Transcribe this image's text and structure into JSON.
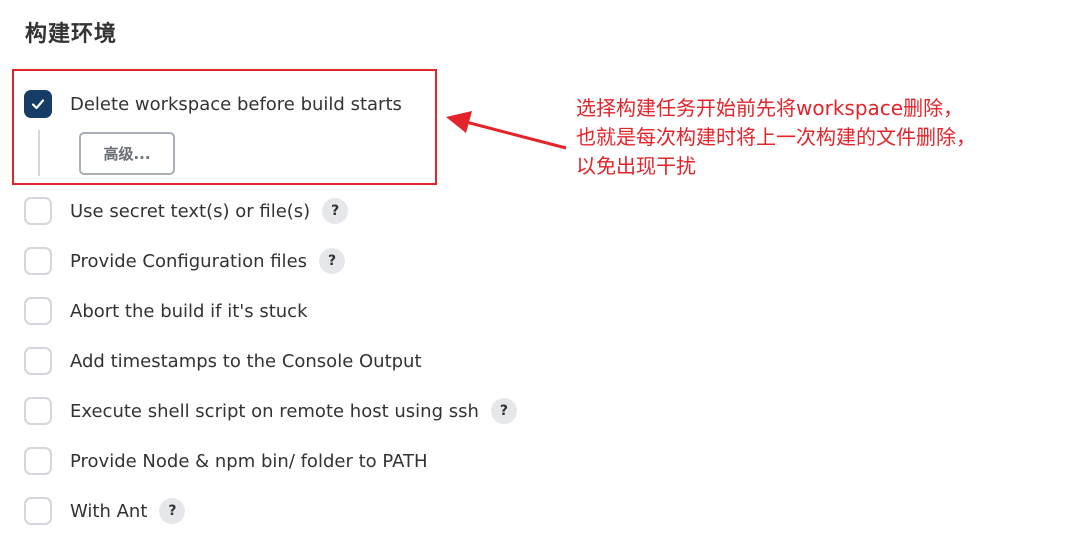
{
  "section": {
    "title": "构建环境"
  },
  "options": [
    {
      "label": "Delete workspace before build starts",
      "checked": true,
      "help": false
    },
    {
      "label": "Use secret text(s) or file(s)",
      "checked": false,
      "help": true
    },
    {
      "label": "Provide Configuration files",
      "checked": false,
      "help": true
    },
    {
      "label": "Abort the build if it's stuck",
      "checked": false,
      "help": false
    },
    {
      "label": "Add timestamps to the Console Output",
      "checked": false,
      "help": false
    },
    {
      "label": "Execute shell script on remote host using ssh",
      "checked": false,
      "help": true
    },
    {
      "label": "Provide Node & npm bin/ folder to PATH",
      "checked": false,
      "help": false
    },
    {
      "label": "With Ant",
      "checked": false,
      "help": true
    }
  ],
  "advanced_button": {
    "label": "高级..."
  },
  "help_icon": {
    "glyph": "?"
  },
  "annotation": {
    "lines": [
      "选择构建任务开始前先将workspace删除，",
      "也就是每次构建时将上一次构建的文件删除，",
      "以免出现干扰"
    ],
    "color": "#e3242b"
  },
  "colors": {
    "checkbox_checked": "#163d66",
    "checkbox_border": "#d4d6dc",
    "highlight": "#e3242b"
  }
}
